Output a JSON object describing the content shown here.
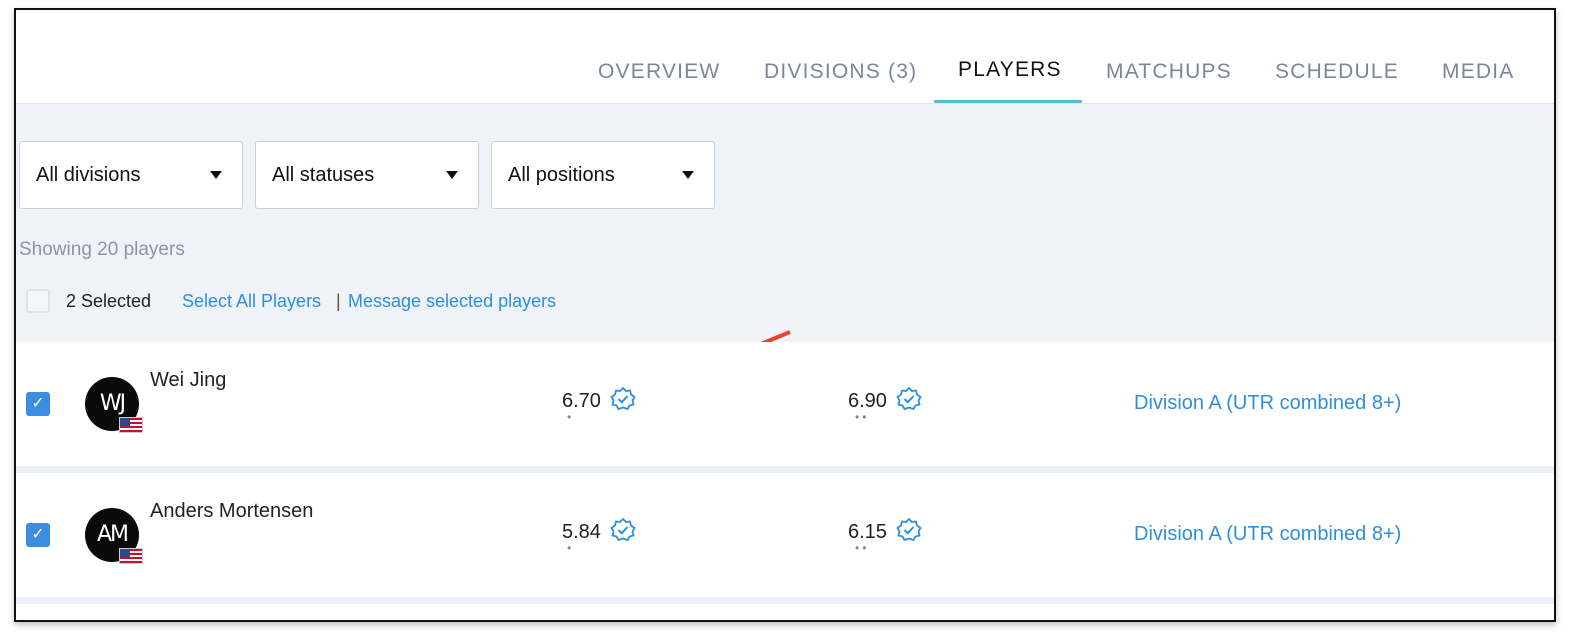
{
  "tabs": [
    {
      "label": "OVERVIEW"
    },
    {
      "label": "DIVISIONS (3)"
    },
    {
      "label": "PLAYERS",
      "active": true
    },
    {
      "label": "MATCHUPS"
    },
    {
      "label": "SCHEDULE"
    },
    {
      "label": "MEDIA"
    }
  ],
  "filters": {
    "division": "All divisions",
    "status": "All statuses",
    "position": "All positions"
  },
  "showing_text": "Showing 20 players",
  "bulk": {
    "selected_text": "2 Selected",
    "select_all_label": "Select All Players",
    "separator": "|",
    "message_label": "Message selected players"
  },
  "players": [
    {
      "name": "Wei Jing",
      "initials": "WJ",
      "rating_singles": "6.70",
      "singles_dots": "•",
      "rating_doubles": "6.90",
      "doubles_dots": "••",
      "division": "Division A (UTR combined 8+)",
      "checked": true
    },
    {
      "name": "Anders Mortensen",
      "initials": "AM",
      "rating_singles": "5.84",
      "singles_dots": "•",
      "rating_doubles": "6.15",
      "doubles_dots": "••",
      "division": "Division A (UTR combined 8+)",
      "checked": true
    }
  ],
  "colors": {
    "accent_link": "#2d8fe0",
    "tab_underline": "#4fc3d4",
    "annotation_arrow": "#e8432f",
    "checkbox_checked": "#3c8de0"
  }
}
